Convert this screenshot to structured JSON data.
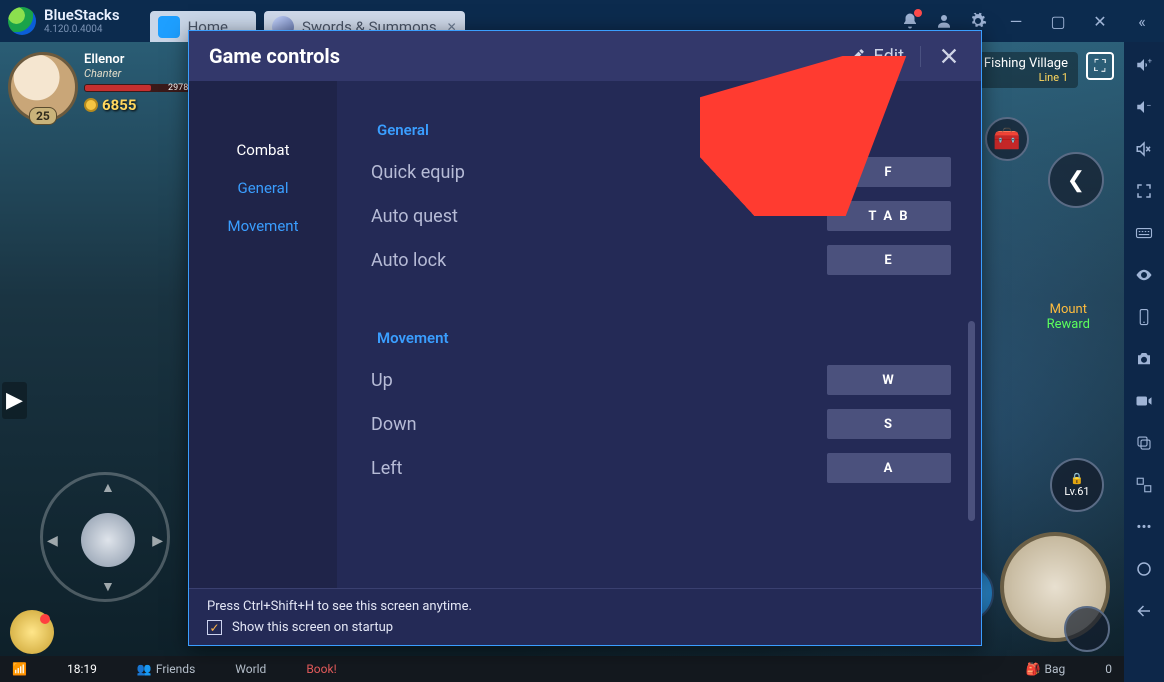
{
  "app": {
    "name": "BlueStacks",
    "version": "4.120.0.4004"
  },
  "tabs": [
    {
      "label": "Home",
      "active": false
    },
    {
      "label": "Swords & Summons",
      "active": true
    }
  ],
  "windowControls": {
    "minimize": "—",
    "maximize": "▢",
    "close": "✕",
    "more": "«"
  },
  "sideToolbar": {
    "items": [
      "volume-up",
      "volume-down",
      "volume-mute",
      "fullscreen",
      "keyboard",
      "location",
      "mobile",
      "camera",
      "record",
      "copy",
      "windows",
      "more",
      "circle",
      "back"
    ]
  },
  "game": {
    "player": {
      "name": "Ellenor",
      "class": "Chanter",
      "level": "25",
      "hp_text": "2978/",
      "coins": "6855"
    },
    "location": {
      "name": "Fishing Village",
      "line": "Line 1"
    },
    "reward": {
      "line1": "Mount",
      "line2": "Reward"
    },
    "lock_level": "Lv.61",
    "treasure": "treasure"
  },
  "bottombar": {
    "time": "18:19",
    "items": [
      "Friends",
      "World",
      "Book!",
      "Bag"
    ],
    "ping": "0"
  },
  "modal": {
    "title": "Game controls",
    "edit": "Edit",
    "nav": [
      "Combat",
      "General",
      "Movement"
    ],
    "sections": [
      {
        "title": "General",
        "rows": [
          {
            "label": "Quick equip",
            "key": "F"
          },
          {
            "label": "Auto quest",
            "key": "T A B"
          },
          {
            "label": "Auto lock",
            "key": "E"
          }
        ]
      },
      {
        "title": "Movement",
        "rows": [
          {
            "label": "Up",
            "key": "W"
          },
          {
            "label": "Down",
            "key": "S"
          },
          {
            "label": "Left",
            "key": "A"
          }
        ]
      }
    ],
    "footer": {
      "hint": "Press Ctrl+Shift+H to see this screen anytime.",
      "checkbox": "Show this screen on startup",
      "checked": true
    }
  }
}
